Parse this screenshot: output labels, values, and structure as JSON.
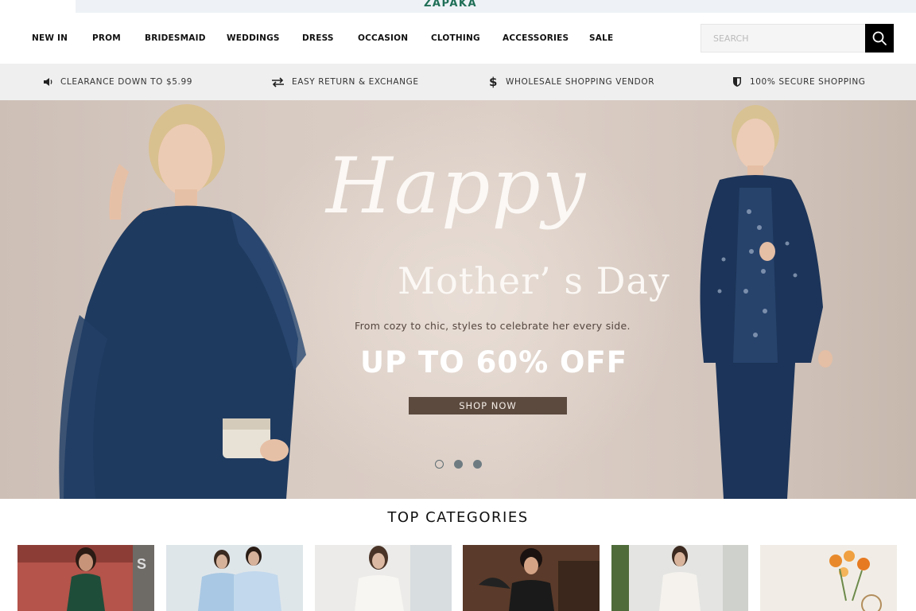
{
  "brand": {
    "logo_text": "ZAPAKA",
    "accent": "#1f6e56"
  },
  "nav": {
    "items": [
      "NEW IN",
      "PROM",
      "BRIDESMAID",
      "WEDDINGS",
      "DRESS",
      "OCCASION",
      "CLOTHING",
      "ACCESSORIES",
      "SALE"
    ]
  },
  "search": {
    "placeholder": "SEARCH",
    "value": "",
    "icon": "search-icon"
  },
  "promo": {
    "items": [
      {
        "icon": "speaker-icon",
        "text": "CLEARANCE DOWN TO $5.99"
      },
      {
        "icon": "exchange-icon",
        "text": "EASY RETURN & EXCHANGE"
      },
      {
        "icon": "dollar-icon",
        "text": "WHOLESALE SHOPPING VENDOR"
      },
      {
        "icon": "shield-icon",
        "text": "100% SECURE SHOPPING"
      }
    ]
  },
  "hero": {
    "script_title": "Happy",
    "subtitle": "Mother’ s Day",
    "tagline": "From cozy to chic, styles to celebrate her every side.",
    "discount": "UP TO 60% OFF",
    "cta": "SHOP NOW",
    "slides": 3,
    "active_slide": 1
  },
  "categories": {
    "title": "TOP CATEGORIES",
    "colors": [
      "#7a3b33",
      "#c9dbe8",
      "#e6e3e0",
      "#4a2f22",
      "#d6d8d4",
      "#f1ede6"
    ]
  }
}
